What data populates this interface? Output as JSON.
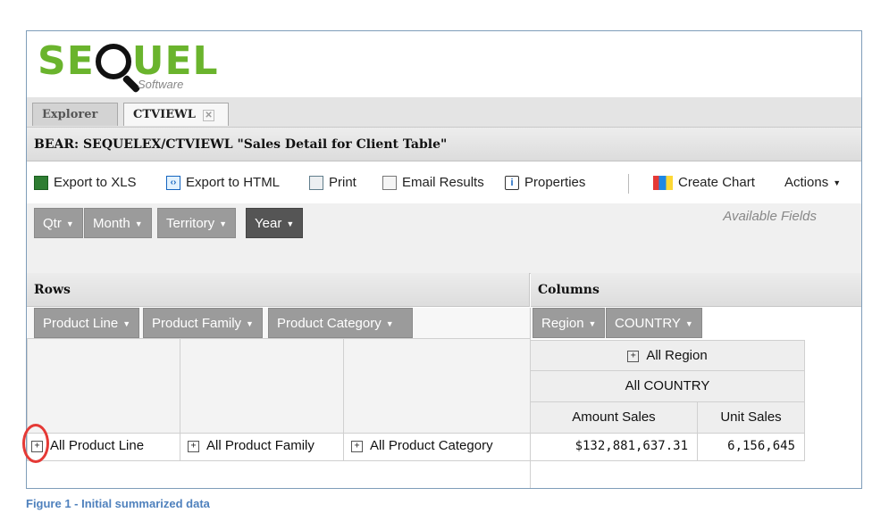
{
  "logo": {
    "brand": "SEQUEL",
    "sub": "Software"
  },
  "tabs": [
    {
      "label": "Explorer"
    },
    {
      "label": "CTVIEWL"
    }
  ],
  "title": "BEAR:  SEQUELEX/CTVIEWL  \"Sales Detail for Client Table\"",
  "toolbar": {
    "export_xls": "Export to XLS",
    "export_html": "Export to HTML",
    "print": "Print",
    "email": "Email Results",
    "properties": "Properties",
    "create_chart": "Create Chart",
    "actions": "Actions"
  },
  "fields": {
    "available_label": "Available Fields",
    "pills": [
      "Qtr",
      "Month",
      "Territory",
      "Year"
    ]
  },
  "rows_section": {
    "title": "Rows",
    "pills": [
      "Product Line",
      "Product Family",
      "Product Category"
    ]
  },
  "columns_section": {
    "title": "Columns",
    "pills": [
      "Region",
      "COUNTRY"
    ]
  },
  "grid": {
    "region_header": "All Region",
    "country_header": "All COUNTRY",
    "measure_headers": [
      "Amount Sales",
      "Unit Sales"
    ],
    "row": {
      "product_line": "All Product Line",
      "product_family": "All Product Family",
      "product_category": "All Product Category",
      "amount_sales": "$132,881,637.31",
      "unit_sales": "6,156,645"
    }
  },
  "caption": "Figure 1 - Initial summarized data",
  "colors": {
    "brand_green": "#6ab42d",
    "highlight_red": "#e53935",
    "caption_blue": "#4f81bd"
  }
}
